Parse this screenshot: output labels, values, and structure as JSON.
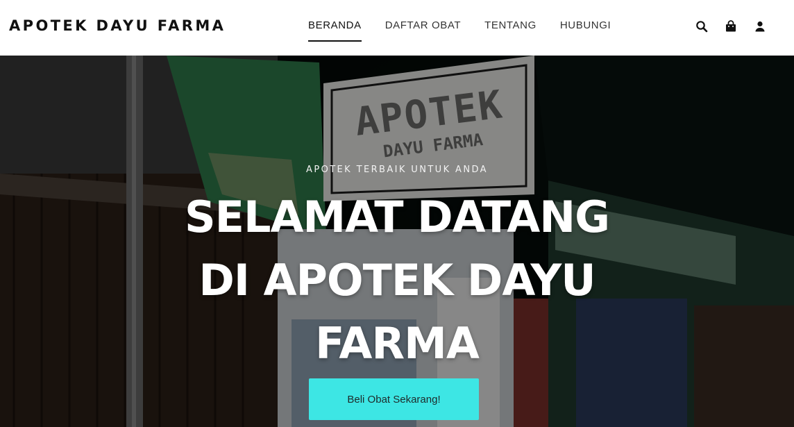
{
  "brand": "APOTEK DAYU FARMA",
  "nav": {
    "items": [
      {
        "label": "BERANDA",
        "active": true
      },
      {
        "label": "DAFTAR OBAT",
        "active": false
      },
      {
        "label": "TENTANG",
        "active": false
      },
      {
        "label": "HUBUNGI",
        "active": false
      }
    ]
  },
  "icons": [
    "search-icon",
    "shopping-bag-icon",
    "user-icon"
  ],
  "hero": {
    "subtitle": "APOTEK TERBAIK UNTUK ANDA",
    "headline": "SELAMAT DATANG DI APOTEK DAYU FARMA",
    "cta_label": "Beli Obat Sekarang!",
    "sign": {
      "line1": "APOTEK",
      "line2": "DAYU FARMA"
    }
  },
  "colors": {
    "accent": "#3de6e4",
    "navbar_bg": "#ffffff",
    "text_dark": "#111111"
  }
}
